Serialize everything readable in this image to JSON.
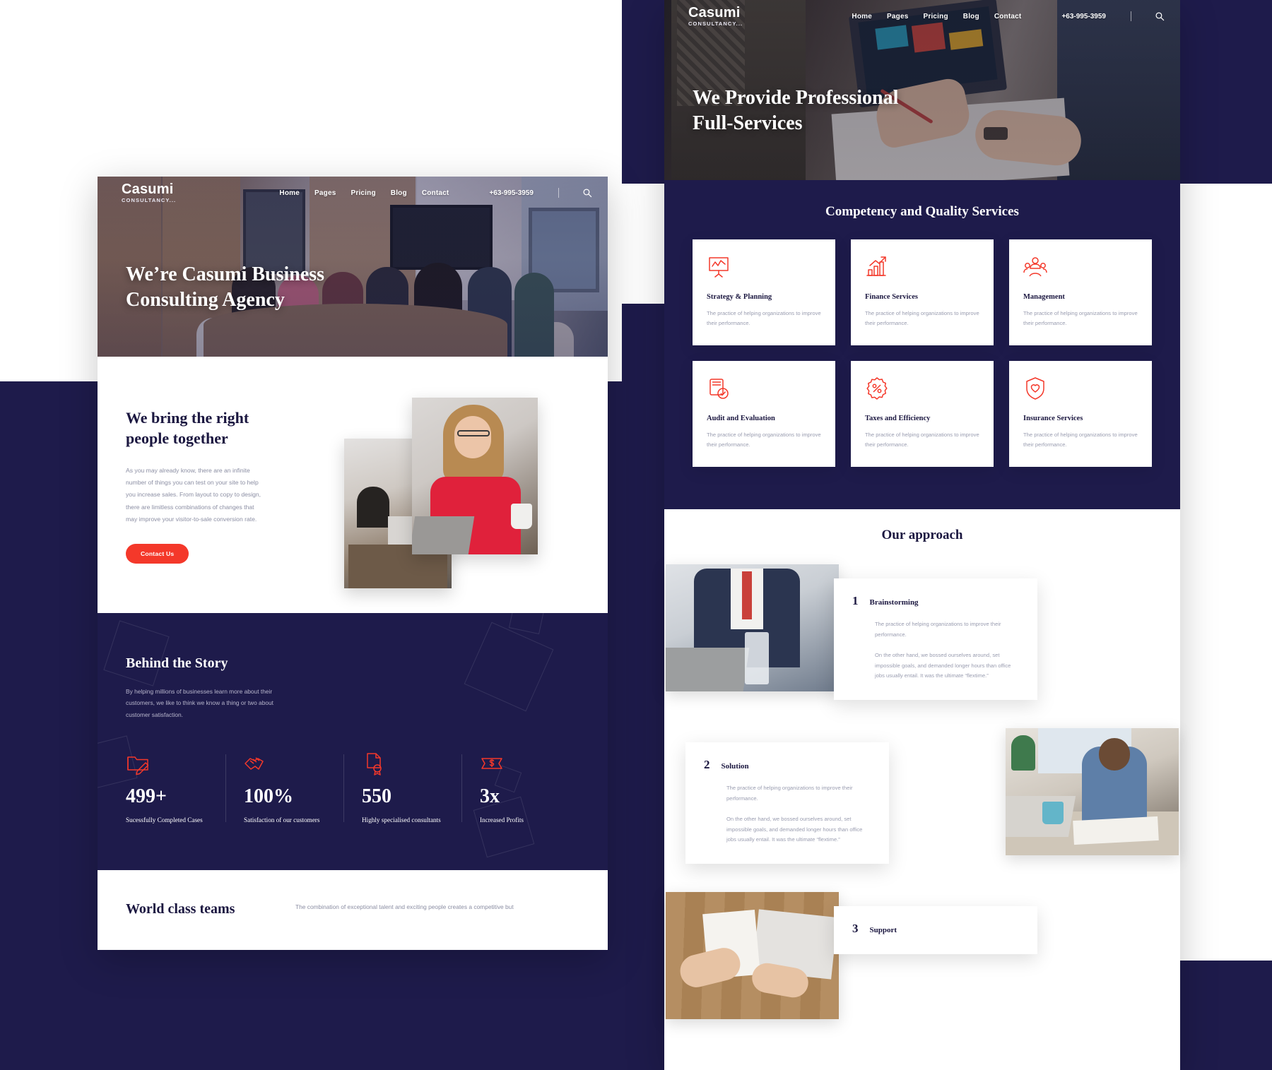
{
  "brand": {
    "name": "Casumi",
    "sub": "CONSULTANCY..."
  },
  "nav": {
    "items": [
      {
        "label": "Home"
      },
      {
        "label": "Pages"
      },
      {
        "label": "Pricing"
      },
      {
        "label": "Blog"
      },
      {
        "label": "Contact"
      }
    ],
    "phone": "+63-995-3959",
    "search_icon": "search-icon"
  },
  "left_page": {
    "hero": {
      "title": "We’re Casumi Business Consulting Agency"
    },
    "about": {
      "title": "We bring the right people together",
      "body": "As you may already know, there are an infinite number of things you can test on your site to help you increase sales. From layout to copy to design, there are limitless combinations of changes that may improve your visitor-to-sale conversion rate.",
      "cta": "Contact Us"
    },
    "story": {
      "title": "Behind the Story",
      "body": "By helping millions of businesses learn more about their customers, we like to think we know a thing or two about customer satisfaction.",
      "stats": [
        {
          "icon": "folder-pencil-icon",
          "number": "499+",
          "label": "Sucessfully Completed Cases"
        },
        {
          "icon": "handshake-icon",
          "number": "100%",
          "label": "Satisfaction of our customers"
        },
        {
          "icon": "certificate-document-icon",
          "number": "550",
          "label": "Highly specialised consultants"
        },
        {
          "icon": "money-ticket-icon",
          "number": "3x",
          "label": "Increased Profits"
        }
      ]
    },
    "teams": {
      "title": "World class teams",
      "body": "The combination of exceptional talent and exciting people creates a competitive but"
    }
  },
  "right_page": {
    "hero": {
      "title": "We Provide Professional Full-Services"
    },
    "services": {
      "title": "Competency and Quality Services",
      "cards": [
        {
          "icon": "presentation-chart-icon",
          "title": "Strategy & Planning",
          "body": "The practice of helping organizations to improve their performance."
        },
        {
          "icon": "bar-chart-growth-icon",
          "title": "Finance Services",
          "body": "The practice of helping organizations to improve their performance."
        },
        {
          "icon": "people-group-icon",
          "title": "Management",
          "body": "The practice of helping organizations to improve their performance."
        },
        {
          "icon": "document-check-icon",
          "title": "Audit and Evaluation",
          "body": "The practice of helping organizations to improve their performance."
        },
        {
          "icon": "percent-badge-icon",
          "title": "Taxes and Efficiency",
          "body": "The practice of helping organizations to improve their performance."
        },
        {
          "icon": "shield-heart-icon",
          "title": "Insurance Services",
          "body": "The practice of helping organizations to improve their performance."
        }
      ]
    },
    "approach": {
      "title": "Our approach",
      "steps": [
        {
          "number": "1",
          "title": "Brainstorming",
          "body1": "The practice of helping organizations to improve their performance.",
          "body2": "On the other hand, we bossed ourselves around, set impossible goals, and demanded longer hours than office jobs usually entail. It was the ultimate “flextime.”"
        },
        {
          "number": "2",
          "title": "Solution",
          "body1": "The practice of helping organizations to improve their performance.",
          "body2": "On the other hand, we bossed ourselves around, set impossible goals, and demanded longer hours than office jobs usually entail. It was the ultimate “flextime.”"
        },
        {
          "number": "3",
          "title": "Support",
          "body1": "",
          "body2": ""
        }
      ]
    }
  },
  "colors": {
    "navy": "#1e1b4b",
    "accent_red": "#f4382a",
    "card_white": "#ffffff",
    "muted_text": "#9a9db0"
  }
}
